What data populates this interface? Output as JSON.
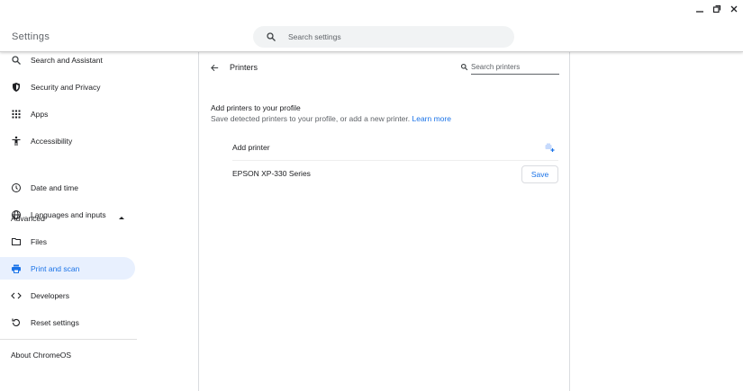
{
  "header": {
    "title": "Settings",
    "search_placeholder": "Search settings"
  },
  "sidebar": {
    "items": [
      {
        "label": "Search and Assistant",
        "icon": "search-icon"
      },
      {
        "label": "Security and Privacy",
        "icon": "shield-icon"
      },
      {
        "label": "Apps",
        "icon": "apps-grid-icon"
      },
      {
        "label": "Accessibility",
        "icon": "accessibility-icon"
      },
      {
        "label": "Date and time",
        "icon": "clock-icon"
      },
      {
        "label": "Languages and inputs",
        "icon": "globe-icon"
      },
      {
        "label": "Files",
        "icon": "folder-icon"
      },
      {
        "label": "Print and scan",
        "icon": "printer-icon",
        "selected": true
      },
      {
        "label": "Developers",
        "icon": "code-icon"
      },
      {
        "label": "Reset settings",
        "icon": "reset-icon"
      }
    ],
    "advanced_label": "Advanced",
    "about_label": "About ChromeOS"
  },
  "page": {
    "title": "Printers",
    "search_placeholder": "Search printers",
    "section_title": "Add printers to your profile",
    "section_desc": "Save detected printers to your profile, or add a new printer.",
    "learn_more": "Learn more",
    "add_printer_label": "Add printer",
    "printers": [
      {
        "name": "EPSON XP-330 Series",
        "action": "Save"
      }
    ]
  },
  "colors": {
    "accent": "#1a73e8",
    "selected_bg": "#e8f0fe"
  }
}
